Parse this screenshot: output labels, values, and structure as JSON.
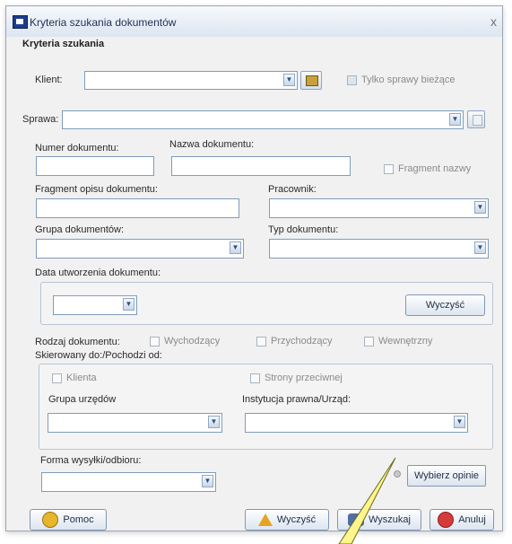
{
  "window": {
    "title": "Kryteria szukania dokumentów",
    "close_glyph": "x"
  },
  "section_title": "Kryteria szukania",
  "klient": {
    "label": "Klient:",
    "value": ""
  },
  "tylko_sprawy": {
    "label": "Tylko sprawy bieżące",
    "checked": true
  },
  "sprawa": {
    "label": "Sprawa:",
    "value": ""
  },
  "numer": {
    "label": "Numer dokumentu:",
    "value": ""
  },
  "nazwa": {
    "label": "Nazwa dokumentu:",
    "value": ""
  },
  "fragment_nazwy": {
    "label": "Fragment nazwy",
    "checked": false
  },
  "fragment_opisu": {
    "label": "Fragment opisu dokumentu:",
    "value": ""
  },
  "pracownik": {
    "label": "Pracownik:",
    "value": ""
  },
  "grupa_dok": {
    "label": "Grupa dokumentów:",
    "value": ""
  },
  "typ_dok": {
    "label": "Typ dokumentu:",
    "value": ""
  },
  "data_utworzenia": {
    "label": "Data utworzenia dokumentu:",
    "value": "",
    "clear_label": "Wyczyść"
  },
  "rodzaj": {
    "label": "Rodzaj dokumentu:",
    "options": [
      "Wychodzący",
      "Przychodzący",
      "Wewnętrzny"
    ]
  },
  "skierowany": {
    "label": "Skierowany do:/Pochodzi od:",
    "klienta_label": "Klienta",
    "strony_label": "Strony przeciwnej",
    "grupa_urzedow_label": "Grupa urzędów",
    "instytucja_label": "Instytucja prawna/Urząd:"
  },
  "forma": {
    "label": "Forma wysyłki/odbioru:",
    "value": ""
  },
  "wybierz_opinie_label": "Wybierz opinie",
  "buttons": {
    "pomoc": "Pomoc",
    "wyczysc": "Wyczyść",
    "wyszukaj": "Wyszukaj",
    "anuluj": "Anuluj"
  },
  "icons": {
    "app": "app-icon",
    "dropdown": "chevron-down-icon",
    "pick": "search-list-icon",
    "help": "help-icon",
    "clear": "warning-icon",
    "search": "binoculars-icon",
    "cancel": "cancel-icon"
  },
  "colors": {
    "title": "#20335a",
    "border": "#7f9db9",
    "cancel": "#d63b3b",
    "help": "#e8b62a"
  }
}
